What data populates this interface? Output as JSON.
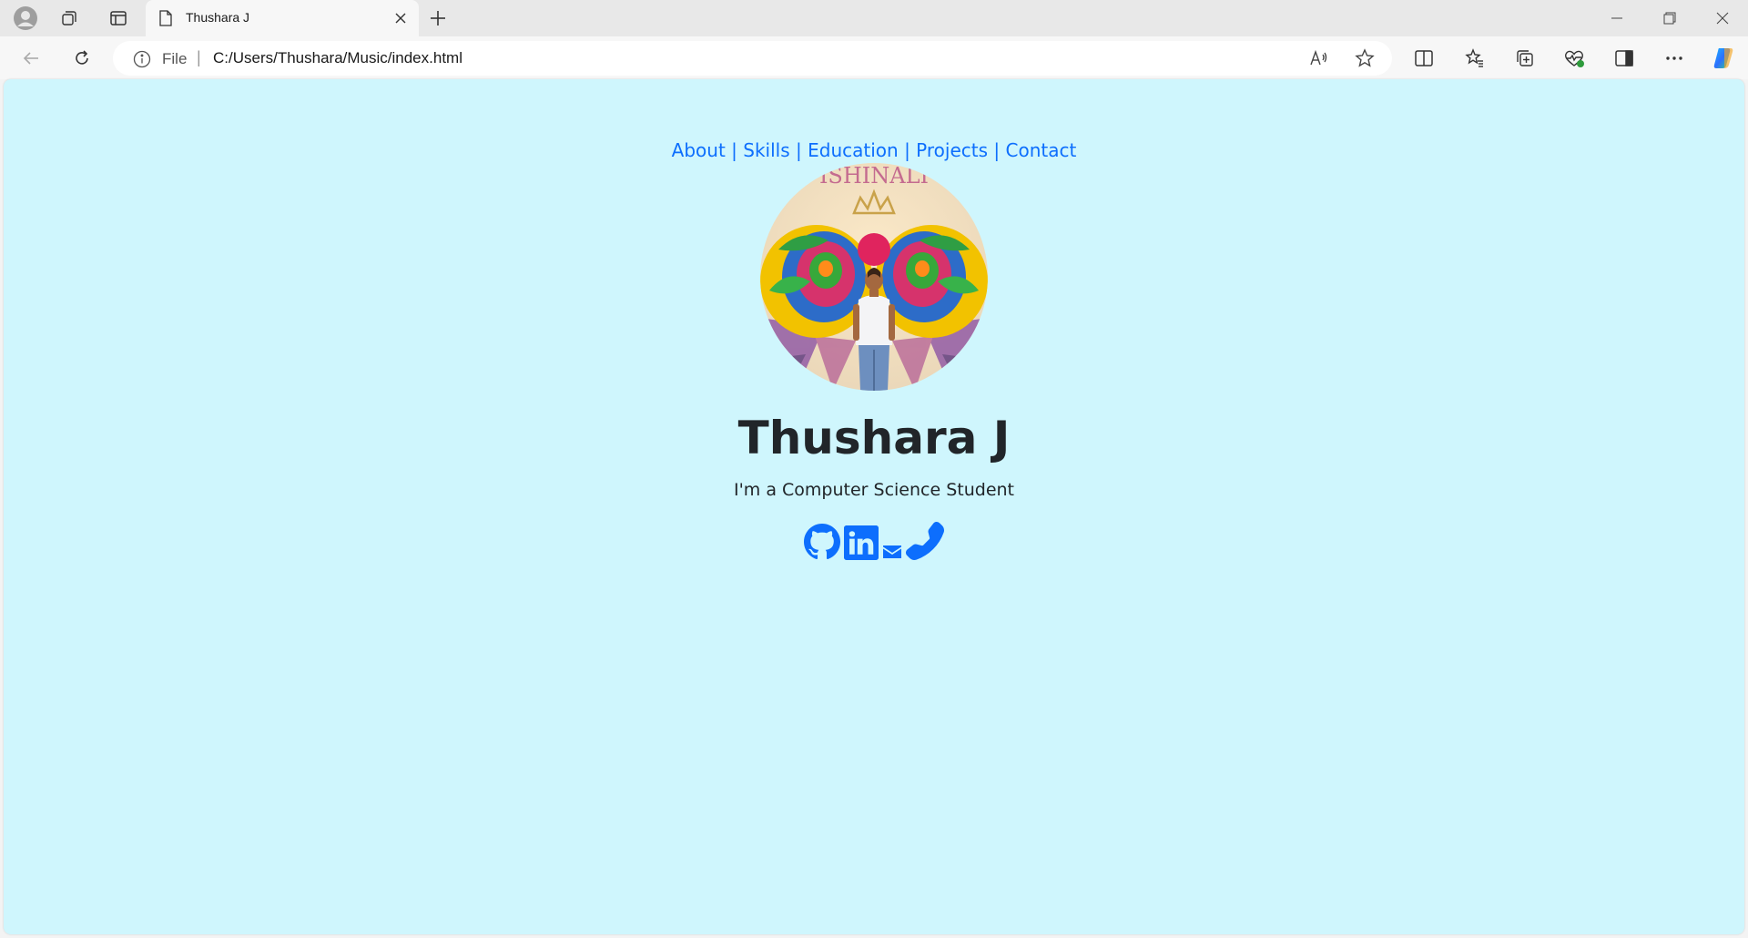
{
  "browser": {
    "tab_title": "Thushara J",
    "address_prefix": "File",
    "address_separator": "|",
    "url": "C:/Users/Thushara/Music/index.html"
  },
  "page": {
    "nav": [
      {
        "label": "About"
      },
      {
        "label": "Skills"
      },
      {
        "label": "Education"
      },
      {
        "label": "Projects"
      },
      {
        "label": "Contact"
      }
    ],
    "nav_separator": "|",
    "name": "Thushara J",
    "subtitle": "I'm a Computer Science Student",
    "socials": [
      "github-icon",
      "linkedin-icon",
      "email-icon",
      "phone-icon"
    ]
  },
  "colors": {
    "page_background": "#cff6fd",
    "link": "#0d6efd",
    "text": "#212529"
  }
}
